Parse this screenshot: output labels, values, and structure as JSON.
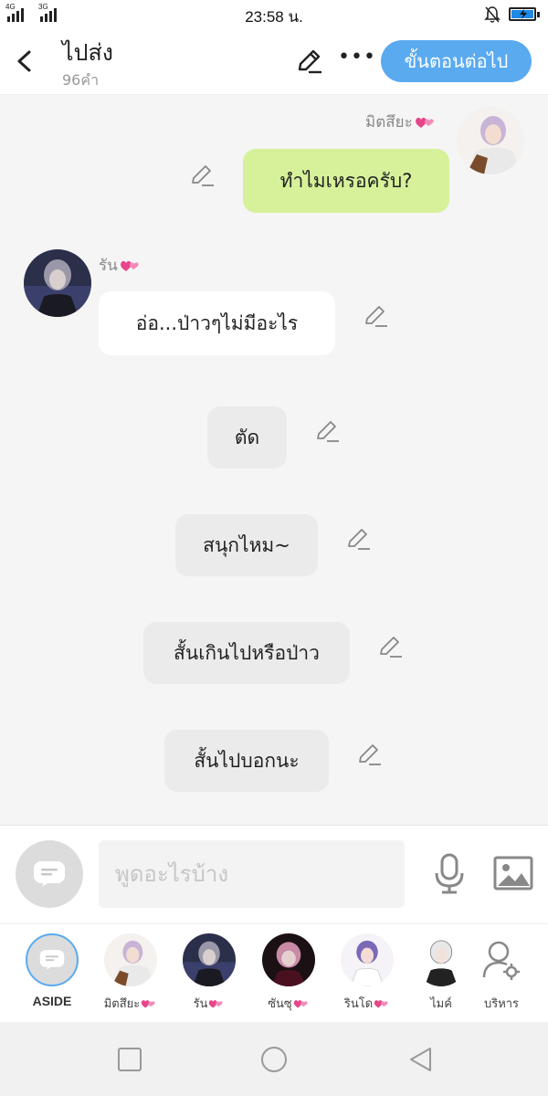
{
  "status_bar": {
    "network_1": "4G",
    "network_2": "3G",
    "time": "23:58 น."
  },
  "header": {
    "title": "ไปส่ง",
    "word_count": "96คำ",
    "next_button": "ขั้นตอนต่อไป"
  },
  "messages": [
    {
      "speaker": "มิตสึยะ",
      "text": "ทำไมเหรอครับ?",
      "side": "right",
      "style": "green"
    },
    {
      "speaker": "รัน",
      "text": "อ่อ...ป่าวๆไม่มีอะไร",
      "side": "left",
      "style": "white"
    },
    {
      "speaker": "",
      "text": "ตัด",
      "side": "center",
      "style": "grey"
    },
    {
      "speaker": "",
      "text": "สนุกไหม~",
      "side": "center",
      "style": "grey"
    },
    {
      "speaker": "",
      "text": "สั้นเกินไปหรือป่าว",
      "side": "center",
      "style": "grey"
    },
    {
      "speaker": "",
      "text": "สั้นไปบอกนะ",
      "side": "center",
      "style": "grey"
    }
  ],
  "input": {
    "placeholder": "พูดอะไรบ้าง",
    "value": ""
  },
  "characters": [
    {
      "label": "ASIDE"
    },
    {
      "label": "มิตสึยะ"
    },
    {
      "label": "รัน"
    },
    {
      "label": "ซันซุ"
    },
    {
      "label": "รินโด"
    },
    {
      "label": "ไมค์"
    },
    {
      "label": "บริหาร"
    }
  ],
  "colors": {
    "accent": "#5aaaf0",
    "bubble_green": "#d6f19a",
    "bubble_grey": "#ebebeb",
    "heart": "#e8458a"
  },
  "icons": [
    "back-arrow-icon",
    "pencil-icon",
    "more-icon",
    "chat-bubble-icon",
    "mic-icon",
    "image-icon",
    "person-gear-icon",
    "heart-icon",
    "square-icon",
    "circle-icon",
    "triangle-back-icon"
  ]
}
